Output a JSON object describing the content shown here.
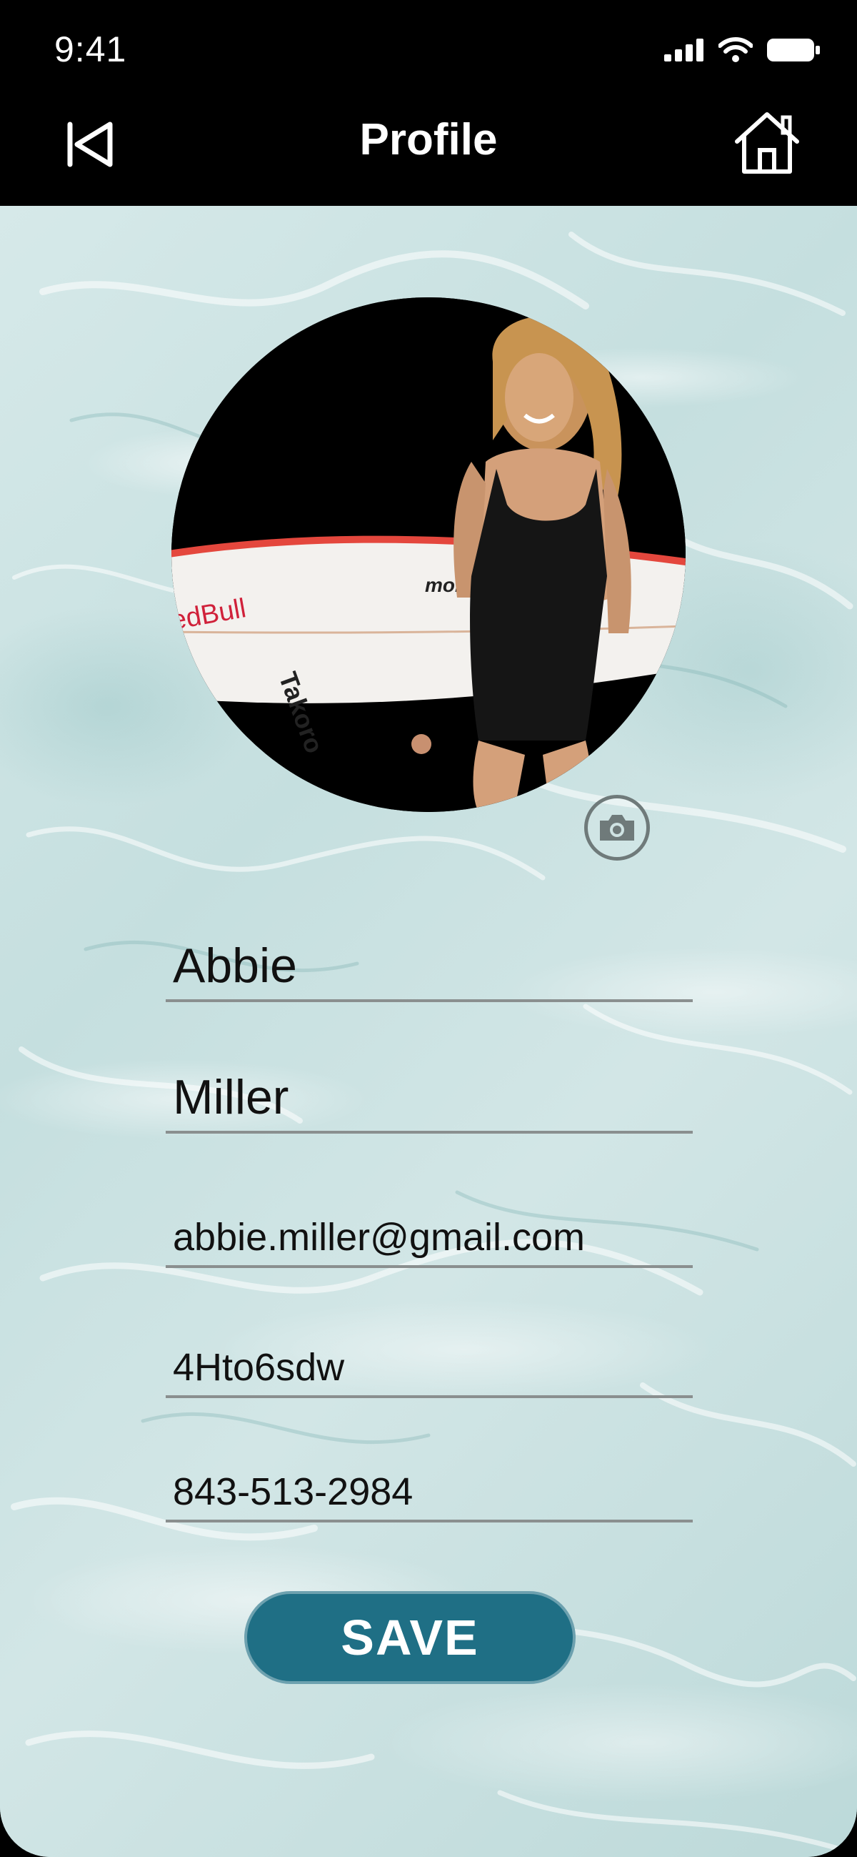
{
  "status_bar": {
    "time": "9:41"
  },
  "header": {
    "title": "Profile",
    "back_icon": "back-arrow-icon",
    "home_icon": "home-icon"
  },
  "avatar": {
    "camera_icon": "camera-icon",
    "board_text_1": "edBull",
    "board_text_2": "Takoro",
    "board_text_3": "mormi"
  },
  "form": {
    "first_name": "Abbie",
    "last_name": "Miller",
    "email": "abbie.miller@gmail.com",
    "password": "4Hto6sdw",
    "phone": "843-513-2984"
  },
  "actions": {
    "save_label": "SAVE"
  },
  "colors": {
    "accent": "#1f6f85",
    "bar": "#000000",
    "background": "#c9e2e2"
  }
}
